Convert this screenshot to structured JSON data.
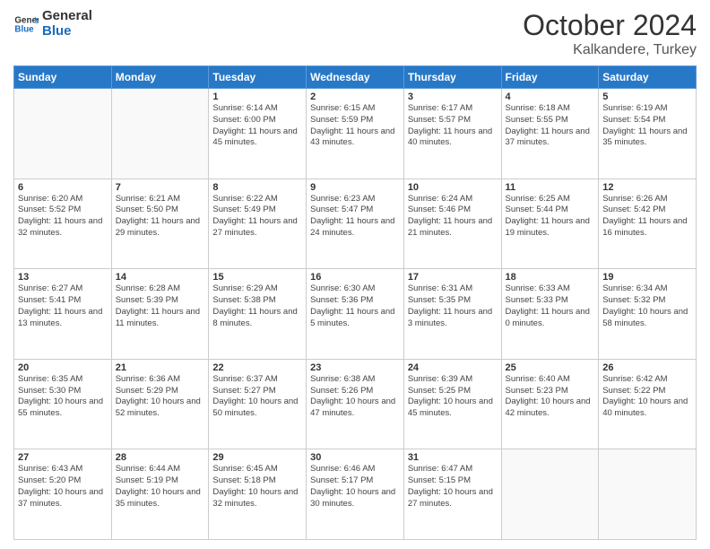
{
  "header": {
    "logo_line1": "General",
    "logo_line2": "Blue",
    "month": "October 2024",
    "location": "Kalkandere, Turkey"
  },
  "weekdays": [
    "Sunday",
    "Monday",
    "Tuesday",
    "Wednesday",
    "Thursday",
    "Friday",
    "Saturday"
  ],
  "weeks": [
    [
      {
        "day": "",
        "info": ""
      },
      {
        "day": "",
        "info": ""
      },
      {
        "day": "1",
        "info": "Sunrise: 6:14 AM\nSunset: 6:00 PM\nDaylight: 11 hours and 45 minutes."
      },
      {
        "day": "2",
        "info": "Sunrise: 6:15 AM\nSunset: 5:59 PM\nDaylight: 11 hours and 43 minutes."
      },
      {
        "day": "3",
        "info": "Sunrise: 6:17 AM\nSunset: 5:57 PM\nDaylight: 11 hours and 40 minutes."
      },
      {
        "day": "4",
        "info": "Sunrise: 6:18 AM\nSunset: 5:55 PM\nDaylight: 11 hours and 37 minutes."
      },
      {
        "day": "5",
        "info": "Sunrise: 6:19 AM\nSunset: 5:54 PM\nDaylight: 11 hours and 35 minutes."
      }
    ],
    [
      {
        "day": "6",
        "info": "Sunrise: 6:20 AM\nSunset: 5:52 PM\nDaylight: 11 hours and 32 minutes."
      },
      {
        "day": "7",
        "info": "Sunrise: 6:21 AM\nSunset: 5:50 PM\nDaylight: 11 hours and 29 minutes."
      },
      {
        "day": "8",
        "info": "Sunrise: 6:22 AM\nSunset: 5:49 PM\nDaylight: 11 hours and 27 minutes."
      },
      {
        "day": "9",
        "info": "Sunrise: 6:23 AM\nSunset: 5:47 PM\nDaylight: 11 hours and 24 minutes."
      },
      {
        "day": "10",
        "info": "Sunrise: 6:24 AM\nSunset: 5:46 PM\nDaylight: 11 hours and 21 minutes."
      },
      {
        "day": "11",
        "info": "Sunrise: 6:25 AM\nSunset: 5:44 PM\nDaylight: 11 hours and 19 minutes."
      },
      {
        "day": "12",
        "info": "Sunrise: 6:26 AM\nSunset: 5:42 PM\nDaylight: 11 hours and 16 minutes."
      }
    ],
    [
      {
        "day": "13",
        "info": "Sunrise: 6:27 AM\nSunset: 5:41 PM\nDaylight: 11 hours and 13 minutes."
      },
      {
        "day": "14",
        "info": "Sunrise: 6:28 AM\nSunset: 5:39 PM\nDaylight: 11 hours and 11 minutes."
      },
      {
        "day": "15",
        "info": "Sunrise: 6:29 AM\nSunset: 5:38 PM\nDaylight: 11 hours and 8 minutes."
      },
      {
        "day": "16",
        "info": "Sunrise: 6:30 AM\nSunset: 5:36 PM\nDaylight: 11 hours and 5 minutes."
      },
      {
        "day": "17",
        "info": "Sunrise: 6:31 AM\nSunset: 5:35 PM\nDaylight: 11 hours and 3 minutes."
      },
      {
        "day": "18",
        "info": "Sunrise: 6:33 AM\nSunset: 5:33 PM\nDaylight: 11 hours and 0 minutes."
      },
      {
        "day": "19",
        "info": "Sunrise: 6:34 AM\nSunset: 5:32 PM\nDaylight: 10 hours and 58 minutes."
      }
    ],
    [
      {
        "day": "20",
        "info": "Sunrise: 6:35 AM\nSunset: 5:30 PM\nDaylight: 10 hours and 55 minutes."
      },
      {
        "day": "21",
        "info": "Sunrise: 6:36 AM\nSunset: 5:29 PM\nDaylight: 10 hours and 52 minutes."
      },
      {
        "day": "22",
        "info": "Sunrise: 6:37 AM\nSunset: 5:27 PM\nDaylight: 10 hours and 50 minutes."
      },
      {
        "day": "23",
        "info": "Sunrise: 6:38 AM\nSunset: 5:26 PM\nDaylight: 10 hours and 47 minutes."
      },
      {
        "day": "24",
        "info": "Sunrise: 6:39 AM\nSunset: 5:25 PM\nDaylight: 10 hours and 45 minutes."
      },
      {
        "day": "25",
        "info": "Sunrise: 6:40 AM\nSunset: 5:23 PM\nDaylight: 10 hours and 42 minutes."
      },
      {
        "day": "26",
        "info": "Sunrise: 6:42 AM\nSunset: 5:22 PM\nDaylight: 10 hours and 40 minutes."
      }
    ],
    [
      {
        "day": "27",
        "info": "Sunrise: 6:43 AM\nSunset: 5:20 PM\nDaylight: 10 hours and 37 minutes."
      },
      {
        "day": "28",
        "info": "Sunrise: 6:44 AM\nSunset: 5:19 PM\nDaylight: 10 hours and 35 minutes."
      },
      {
        "day": "29",
        "info": "Sunrise: 6:45 AM\nSunset: 5:18 PM\nDaylight: 10 hours and 32 minutes."
      },
      {
        "day": "30",
        "info": "Sunrise: 6:46 AM\nSunset: 5:17 PM\nDaylight: 10 hours and 30 minutes."
      },
      {
        "day": "31",
        "info": "Sunrise: 6:47 AM\nSunset: 5:15 PM\nDaylight: 10 hours and 27 minutes."
      },
      {
        "day": "",
        "info": ""
      },
      {
        "day": "",
        "info": ""
      }
    ]
  ]
}
